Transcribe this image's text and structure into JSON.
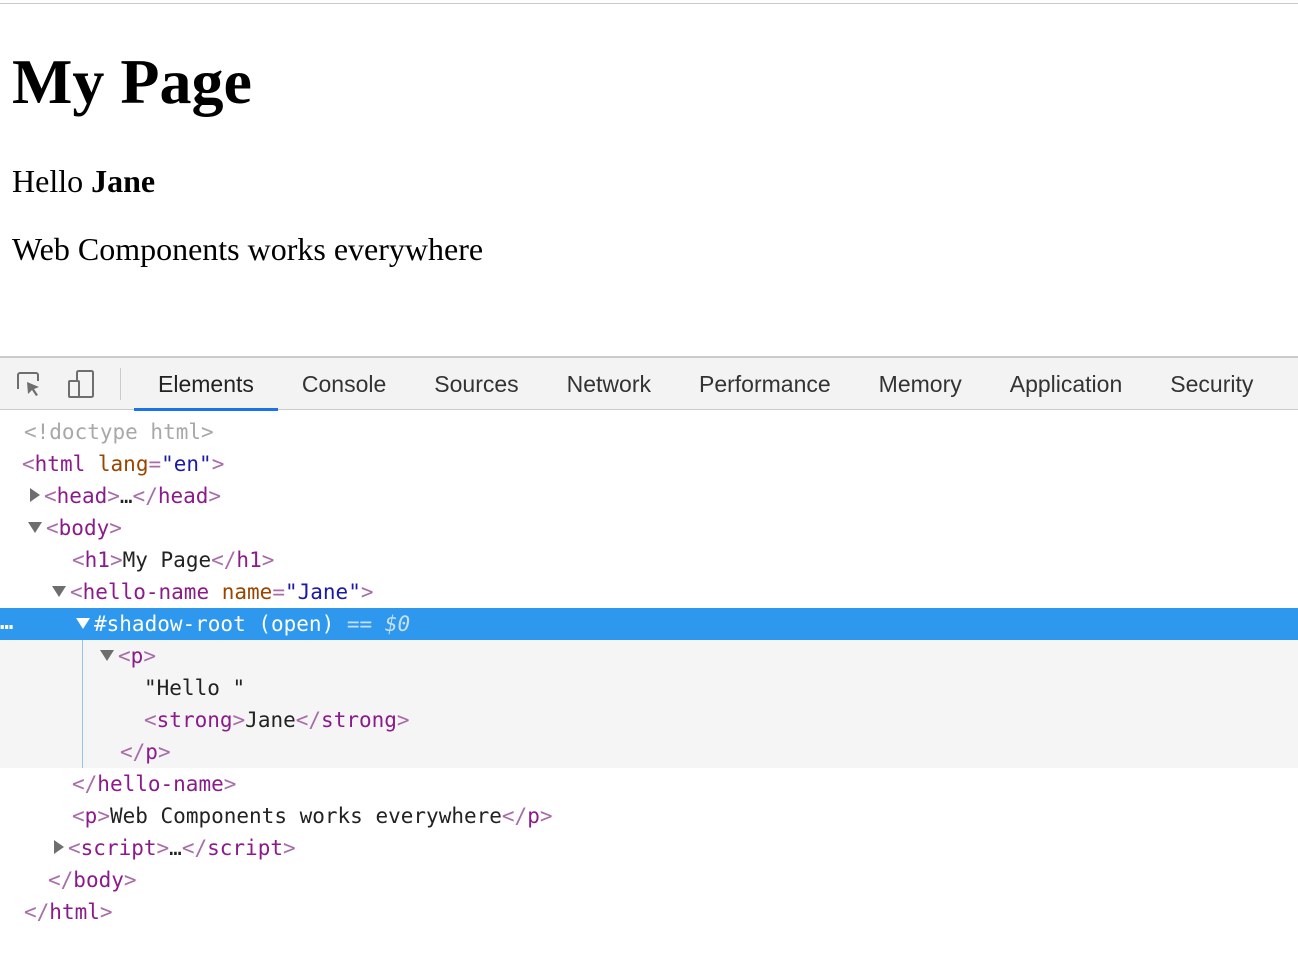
{
  "page": {
    "title": "My Page",
    "greeting_prefix": "Hello ",
    "greeting_name": "Jane",
    "tagline": "Web Components works everywhere"
  },
  "devtools": {
    "toolbar": {
      "inspect_icon": "select-element-icon",
      "device_icon": "device-toolbar-icon"
    },
    "tabs": [
      "Elements",
      "Console",
      "Sources",
      "Network",
      "Performance",
      "Memory",
      "Application",
      "Security"
    ],
    "active_tab": "Elements",
    "tree": {
      "doctype": "<!doctype html>",
      "html_tag": "html",
      "html_lang_attr": "lang",
      "html_lang_value": "\"en\"",
      "head_tag": "head",
      "ellipsis": "…",
      "body_tag": "body",
      "h1_tag": "h1",
      "h1_text": "My Page",
      "hello_tag": "hello-name",
      "hello_attr": "name",
      "hello_value": "\"Jane\"",
      "shadow_root": "#shadow-root (open)",
      "selected_eq": "==",
      "selected_var": "$0",
      "row_dots": "…",
      "p_tag": "p",
      "hello_text": "\"Hello \"",
      "strong_tag": "strong",
      "strong_text": "Jane",
      "p2_text": "Web Components works everywhere",
      "script_tag": "script"
    }
  },
  "colors": {
    "selection": "#2d98ed",
    "active_tab_underline": "#1a73e8",
    "tag": "#8b1a8b",
    "attribute_name": "#994500",
    "attribute_value": "#1a1aa6"
  }
}
